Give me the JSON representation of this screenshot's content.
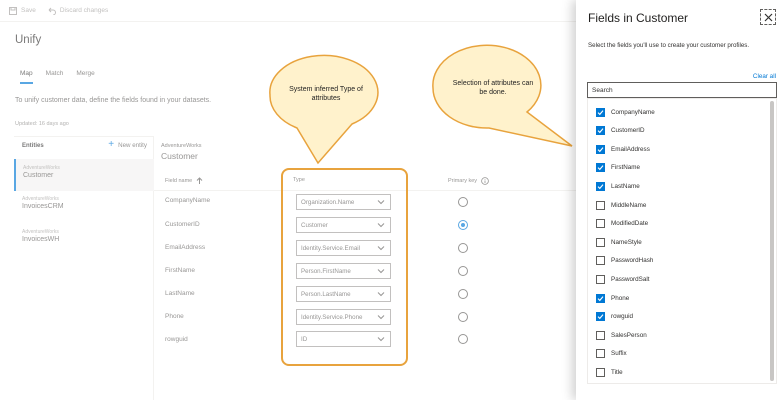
{
  "toolbar": {
    "save_label": "Save",
    "discard_label": "Discard changes"
  },
  "page": {
    "title": "Unify",
    "tabs": [
      {
        "label": "Map"
      },
      {
        "label": "Match"
      },
      {
        "label": "Merge"
      }
    ],
    "instructions": "To unify customer data, define the fields found in your datasets.",
    "updated": "Updated: 16 days ago"
  },
  "entities": {
    "heading": "Entities",
    "new_label": "New entity",
    "items": [
      {
        "source": "AdventureWorks",
        "name": "Customer"
      },
      {
        "source": "AdventureWorks",
        "name": "InvoicesCRM"
      },
      {
        "source": "AdventureWorks",
        "name": "InvoicesWH"
      }
    ]
  },
  "detail": {
    "source": "AdventureWorks",
    "title": "Customer",
    "columns": {
      "field": "Field name",
      "type": "Type",
      "primary_key": "Primary key"
    },
    "rows": [
      {
        "field": "CompanyName",
        "type": "Organization.Name",
        "primary": false
      },
      {
        "field": "CustomerID",
        "type": "Customer",
        "primary": true
      },
      {
        "field": "EmailAddress",
        "type": "Identity.Service.Email",
        "primary": false
      },
      {
        "field": "FirstName",
        "type": "Person.FirstName",
        "primary": false
      },
      {
        "field": "LastName",
        "type": "Person.LastName",
        "primary": false
      },
      {
        "field": "Phone",
        "type": "Identity.Service.Phone",
        "primary": false
      },
      {
        "field": "rowguid",
        "type": "ID",
        "primary": false
      }
    ]
  },
  "annotations": {
    "type_note": "System inferred Type of attributes",
    "selection_note": "Selection of attributes can be done."
  },
  "panel": {
    "title": "Fields in Customer",
    "subtitle": "Select the fields you'll use to create your customer profiles.",
    "clear_all": "Clear all",
    "search_placeholder": "Search",
    "fields": [
      {
        "label": "CompanyName",
        "checked": true
      },
      {
        "label": "CustomerID",
        "checked": true
      },
      {
        "label": "EmailAddress",
        "checked": true
      },
      {
        "label": "FirstName",
        "checked": true
      },
      {
        "label": "LastName",
        "checked": true
      },
      {
        "label": "MiddleName",
        "checked": false
      },
      {
        "label": "ModifiedDate",
        "checked": false
      },
      {
        "label": "NameStyle",
        "checked": false
      },
      {
        "label": "PasswordHash",
        "checked": false
      },
      {
        "label": "PasswordSalt",
        "checked": false
      },
      {
        "label": "Phone",
        "checked": true
      },
      {
        "label": "rowguid",
        "checked": true
      },
      {
        "label": "SalesPerson",
        "checked": false
      },
      {
        "label": "Suffix",
        "checked": false
      },
      {
        "label": "Title",
        "checked": false
      }
    ]
  },
  "colors": {
    "accent": "#0078d4",
    "annotation": "#e8a33d",
    "bubble": "#fff2cc"
  }
}
